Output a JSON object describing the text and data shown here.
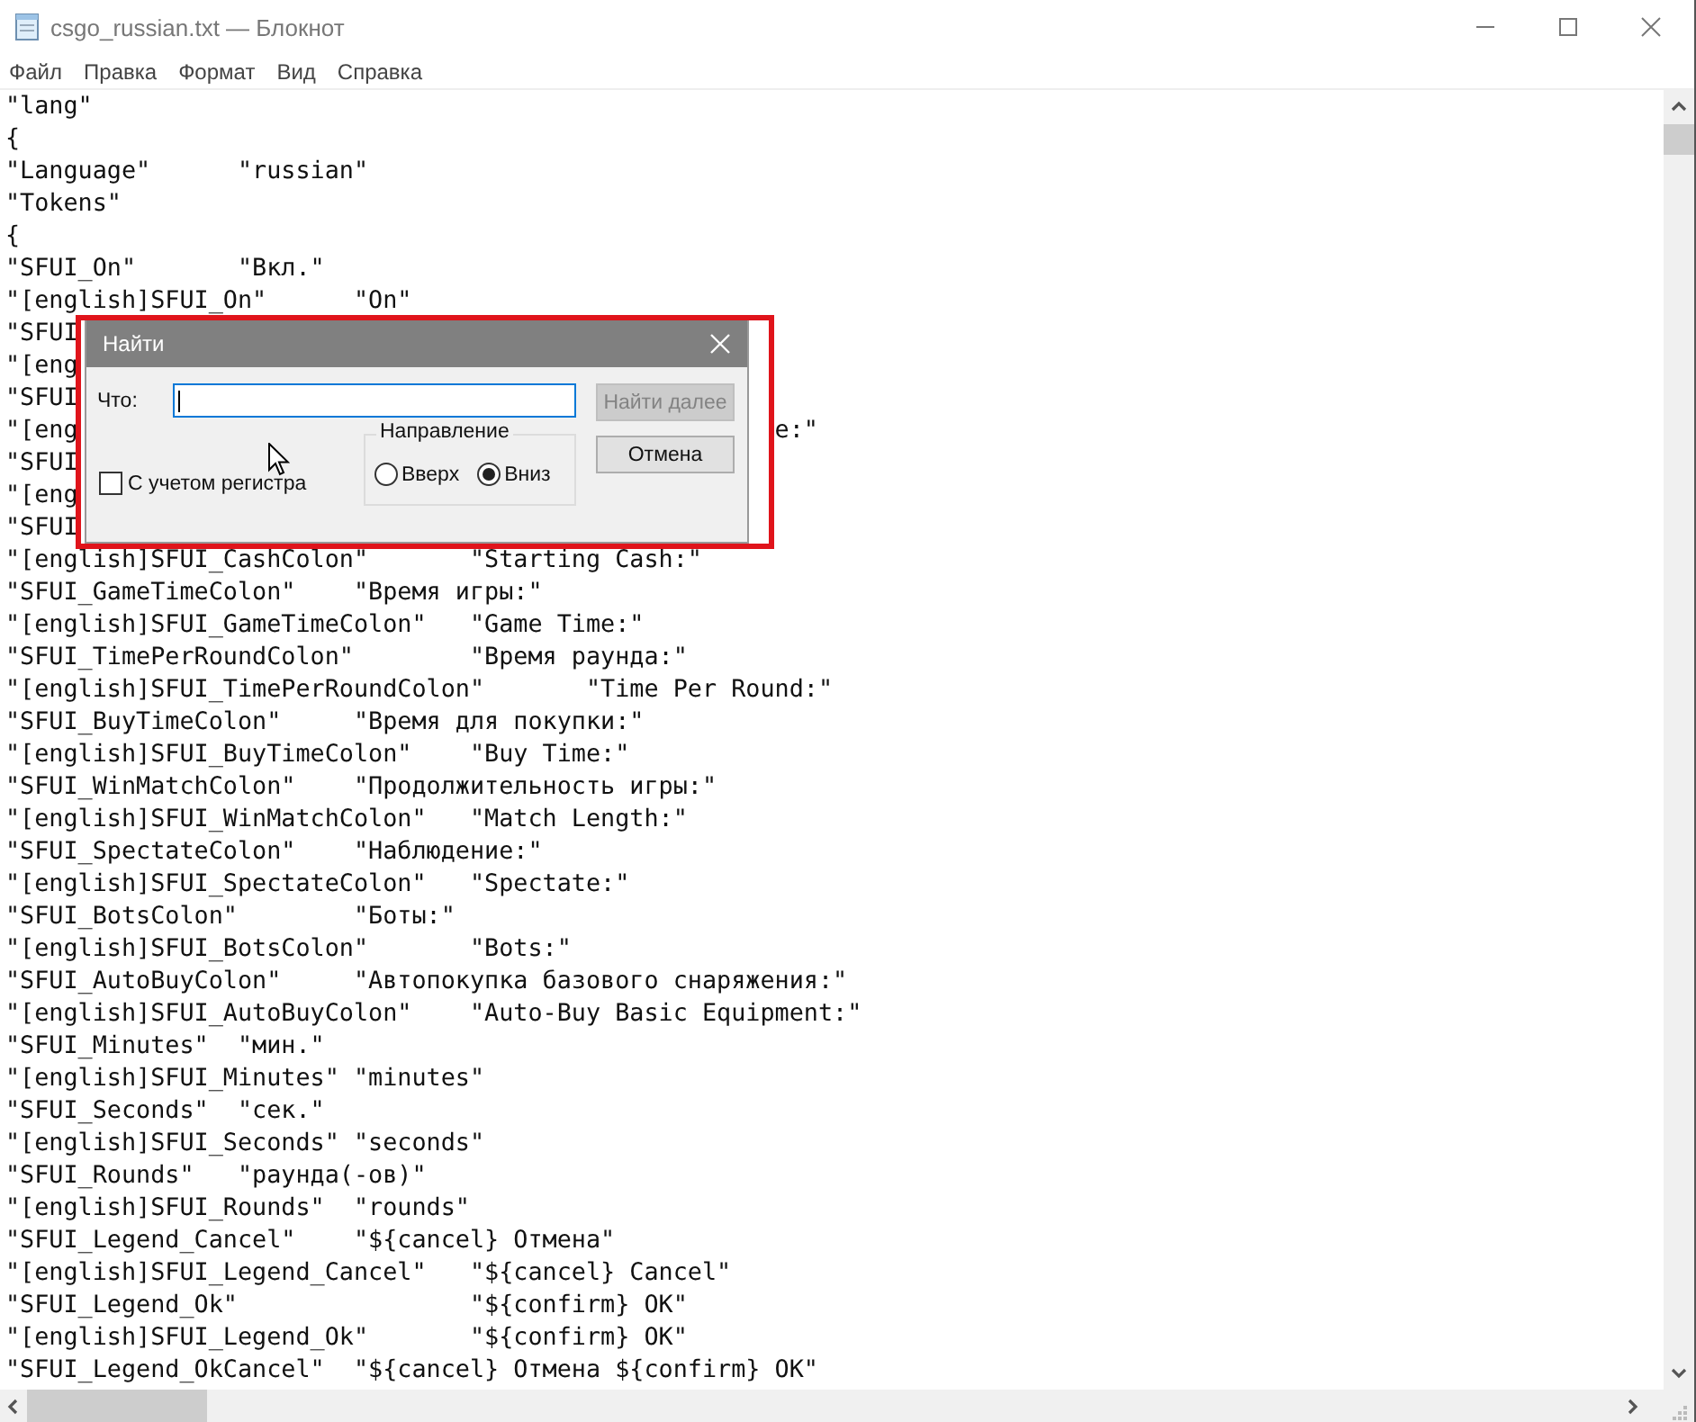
{
  "window": {
    "title": "csgo_russian.txt — Блокнот"
  },
  "menu": [
    "Файл",
    "Правка",
    "Формат",
    "Вид",
    "Справка"
  ],
  "editor": {
    "lines": [
      {
        "text": "\"lang\""
      },
      {
        "text": "{"
      },
      {
        "text": "\"Language\"\t\"russian\""
      },
      {
        "text": "\"Tokens\""
      },
      {
        "text": "{"
      },
      {
        "text": "\"SFUI_On\"\t\"Вкл.\""
      },
      {
        "text": "\"[english]SFUI_On\"\t\"On\""
      },
      {
        "text": "\"SFUI"
      },
      {
        "text": "\"[eng"
      },
      {
        "text": "\"SFUI"
      },
      {
        "text": "\"[eng",
        "tail": "e:\""
      },
      {
        "text": "\"SFUI"
      },
      {
        "text": "\"[eng"
      },
      {
        "text": "\"SFUI"
      },
      {
        "text": "\"[english]SFUI_CashColon\"\t\"Starting Cash:\""
      },
      {
        "text": "\"SFUI_GameTimeColon\"\t\"Время игры:\""
      },
      {
        "text": "\"[english]SFUI_GameTimeColon\"\t\"Game Time:\""
      },
      {
        "text": "\"SFUI_TimePerRoundColon\"\t\"Время раунда:\""
      },
      {
        "text": "\"[english]SFUI_TimePerRoundColon\"\t\"Time Per Round:\""
      },
      {
        "text": "\"SFUI_BuyTimeColon\"\t\"Время для покупки:\""
      },
      {
        "text": "\"[english]SFUI_BuyTimeColon\"\t\"Buy Time:\""
      },
      {
        "text": "\"SFUI_WinMatchColon\"\t\"Продолжительность игры:\""
      },
      {
        "text": "\"[english]SFUI_WinMatchColon\"\t\"Match Length:\""
      },
      {
        "text": "\"SFUI_SpectateColon\"\t\"Наблюдение:\""
      },
      {
        "text": "\"[english]SFUI_SpectateColon\"\t\"Spectate:\""
      },
      {
        "text": "\"SFUI_BotsColon\"\t\"Боты:\""
      },
      {
        "text": "\"[english]SFUI_BotsColon\"\t\"Bots:\""
      },
      {
        "text": "\"SFUI_AutoBuyColon\"\t\"Автопокупка базового снаряжения:\""
      },
      {
        "text": "\"[english]SFUI_AutoBuyColon\"\t\"Auto-Buy Basic Equipment:\""
      },
      {
        "text": "\"SFUI_Minutes\"\t\"мин.\""
      },
      {
        "text": "\"[english]SFUI_Minutes\" \"minutes\""
      },
      {
        "text": "\"SFUI_Seconds\"\t\"сек.\""
      },
      {
        "text": "\"[english]SFUI_Seconds\" \"seconds\""
      },
      {
        "text": "\"SFUI_Rounds\"\t\"раунда(-ов)\""
      },
      {
        "text": "\"[english]SFUI_Rounds\"\t\"rounds\""
      },
      {
        "text": "\"SFUI_Legend_Cancel\"\t\"${cancel} Отмена\""
      },
      {
        "text": "\"[english]SFUI_Legend_Cancel\"\t\"${cancel} Cancel\""
      },
      {
        "text": "\"SFUI_Legend_Ok\"\t\t\"${confirm} OK\""
      },
      {
        "text": "\"[english]SFUI_Legend_Ok\"\t\"${confirm} OK\""
      },
      {
        "text": "\"SFUI_Legend_OkCancel\"\t\"${cancel} Отмена ${confirm} OK\""
      }
    ]
  },
  "find_dialog": {
    "title": "Найти",
    "find_label": "Что:",
    "find_next_button": {
      "label": "Найти далее",
      "disabled": true
    },
    "cancel_button": {
      "label": "Отмена",
      "disabled": false
    },
    "match_case": {
      "label": "С учетом регистра",
      "checked": false
    },
    "direction": {
      "label": "Направление",
      "options": [
        {
          "label": "Вверх",
          "selected": false
        },
        {
          "label": "Вниз",
          "selected": true
        }
      ]
    }
  }
}
